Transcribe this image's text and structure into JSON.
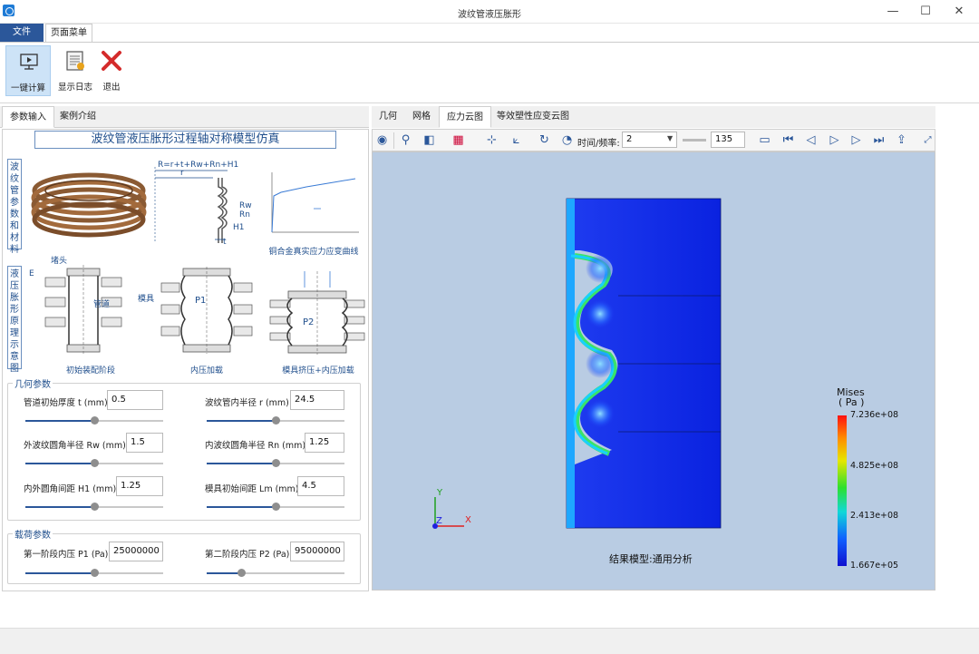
{
  "window": {
    "title": "波纹管液压胀形"
  },
  "menu": {
    "file_label": "文件",
    "page_menu_label": "页面菜单"
  },
  "ribbon": {
    "compute_label": "一键计算",
    "log_label": "显示日志",
    "exit_label": "退出"
  },
  "left_tabs": {
    "params_label": "参数输入",
    "case_label": "案例介绍"
  },
  "diagram": {
    "title": "波纹管液压胀形过程轴对称模型仿真",
    "side_label_top": "波纹管参数和材料",
    "side_label_bottom": "液压胀形原理示意图",
    "formula": "R=r+t+Rw+Rn+H1",
    "labels": {
      "r": "r",
      "rw": "Rw",
      "rn": "Rn",
      "h1": "H1",
      "t": "t",
      "e": "E",
      "plug": "堵头",
      "tube": "管道",
      "die": "模具",
      "p1": "P1",
      "p2": "P2"
    },
    "stress_caption": "铜合金真实应力应变曲线",
    "stage1_caption": "初始装配阶段",
    "stage2_caption": "内压加载",
    "stage3_caption": "模具挤压+内压加载"
  },
  "geometry": {
    "title": "几何参数",
    "params": [
      {
        "label": "管道初始厚度 t (mm)",
        "value": "0.5",
        "slider": 0.5
      },
      {
        "label": "波纹管内半径 r (mm)",
        "value": "24.5",
        "slider": 0.5
      },
      {
        "label": "外波纹圆角半径 Rw (mm)",
        "value": "1.5",
        "slider": 0.5
      },
      {
        "label": "内波纹圆角半径 Rn (mm)",
        "value": "1.25",
        "slider": 0.5
      },
      {
        "label": "内外圆角间距 H1 (mm)",
        "value": "1.25",
        "slider": 0.5
      },
      {
        "label": "模具初始间距 Lm (mm)",
        "value": "4.5",
        "slider": 0.5
      }
    ]
  },
  "load": {
    "title": "载荷参数",
    "params": [
      {
        "label": "第一阶段内压 P1 (Pa)",
        "value": "25000000",
        "slider": 0.5
      },
      {
        "label": "第二阶段内压 P2 (Pa)",
        "value": "95000000",
        "slider": 0.25
      }
    ]
  },
  "right_tabs": [
    "几何",
    "网格",
    "应力云图",
    "等效塑性应变云图"
  ],
  "toolbar": {
    "time_label": "时间/频率:",
    "time_value": "2",
    "frame_value": "135"
  },
  "viewport": {
    "legend_title": "Mises",
    "legend_unit": "( Pa )",
    "legend_values": [
      "7.236e+08",
      "4.825e+08",
      "2.413e+08",
      "1.667e+05"
    ],
    "result_label": "结果模型:通用分析",
    "axis_y": "Y",
    "axis_z": "Z",
    "axis_x": "X"
  },
  "colors": {
    "accent": "#2b579a",
    "viewport_bg": "#b9cce3",
    "diagram_blue": "#1f4e8c"
  }
}
